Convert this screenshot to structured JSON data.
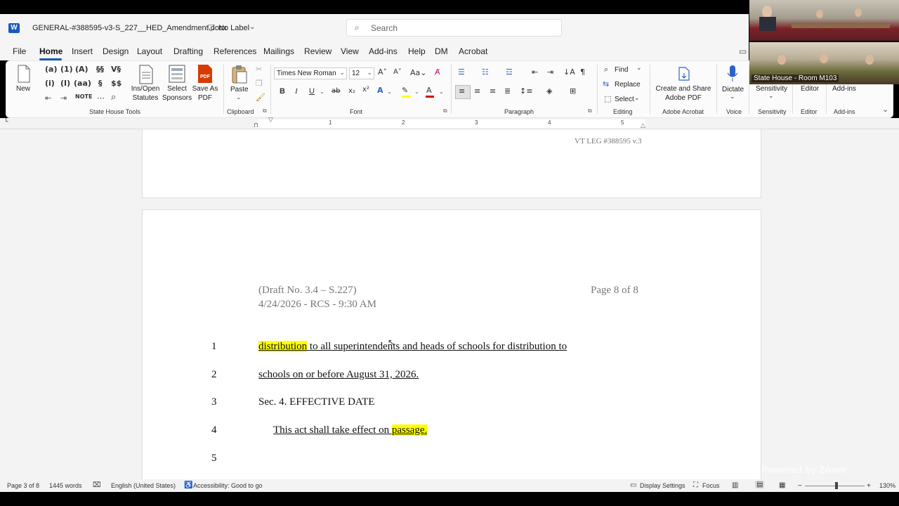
{
  "titlebar": {
    "doc_title": "GENERAL-#388595-v3-S_227__HED_Amendment.docx",
    "label": "No Label",
    "search_placeholder": "Search"
  },
  "menu": [
    "File",
    "Home",
    "Insert",
    "Design",
    "Layout",
    "Drafting",
    "References",
    "Mailings",
    "Review",
    "View",
    "Add-ins",
    "Help",
    "DM",
    "Acrobat"
  ],
  "ribbon": {
    "new_label": "New",
    "state_house_tools": [
      "(a)",
      "(1)",
      "(A)",
      "§§",
      "(i)",
      "(I)",
      "(aa)",
      "§",
      "$$"
    ],
    "ins_open_label": "Ins/Open Statutes",
    "select_sponsors_label": "Select Sponsors",
    "save_pdf_label": "Save As PDF",
    "state_house_tools_group": "State House Tools",
    "paste_label": "Paste",
    "clipboard_group": "Clipboard",
    "font_name": "Times New Roman",
    "font_size": "12",
    "font_group": "Font",
    "bold": "B",
    "italic": "I",
    "underline": "U",
    "paragraph_group": "Paragraph",
    "find_label": "Find",
    "replace_label": "Replace",
    "select_label": "Select",
    "editing_group": "Editing",
    "create_share_label": "Create and Share Adobe PDF",
    "adobe_group": "Adobe Acrobat",
    "dictate_label": "Dictate",
    "voice_group": "Voice",
    "sensitivity_label": "Sensitivity",
    "sensitivity_group": "Sensitivity",
    "editor_label": "Editor",
    "editor_group": "Editor",
    "addins_label": "Add-ins",
    "addins_group": "Add-ins"
  },
  "ruler_numbers": [
    "1",
    "2",
    "3",
    "4",
    "5"
  ],
  "document": {
    "header_ref": "VT LEG #388595 v.3",
    "draft_line1": "(Draft No. 3.4 – S.227)",
    "draft_line2": "4/24/2026 - RCS - 9:30 AM",
    "page_of": "Page 8 of 8",
    "lines": [
      {
        "num": "1",
        "hl": "distribution",
        "rest": " to all superintendents and heads of schools for distribution to"
      },
      {
        "num": "2",
        "text": "schools on or before August 31, 2026."
      },
      {
        "num": "3",
        "text": "Sec. 4.  EFFECTIVE DATE"
      },
      {
        "num": "4",
        "pre": "This act shall take effect on ",
        "hl": "passage."
      },
      {
        "num": "5",
        "text": ""
      }
    ]
  },
  "status": {
    "page": "Page 3 of 8",
    "words": "1445 words",
    "language": "English (United States)",
    "accessibility": "Accessibility: Good to go",
    "display_settings": "Display Settings",
    "focus": "Focus",
    "zoom": "130%"
  },
  "video": {
    "room_name": "State House - Room M103",
    "watermark": "Powered by Zoom"
  },
  "colors": {
    "word_blue": "#185abd",
    "highlight": "#ffff00",
    "pdf_red": "#d83b01"
  }
}
